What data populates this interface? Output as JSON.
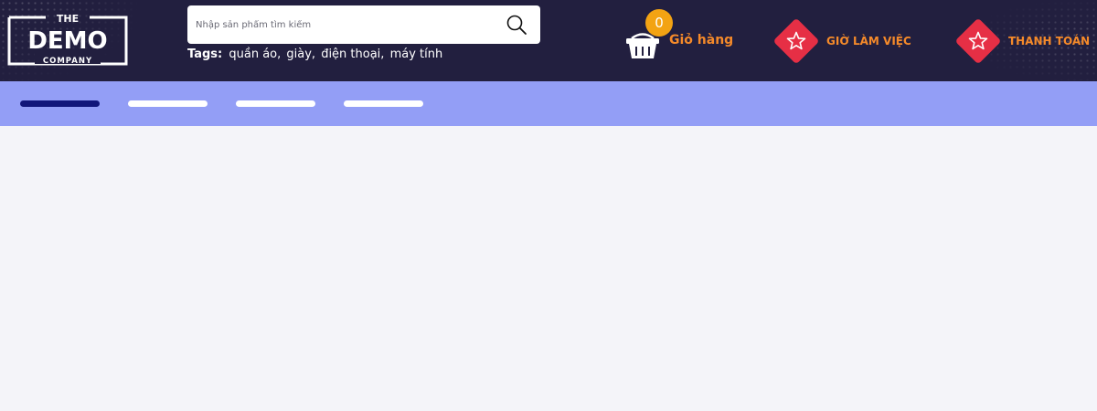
{
  "brand": {
    "logo_top": "THE",
    "logo_main": "DEMO",
    "logo_bottom": "COMPANY"
  },
  "search": {
    "placeholder": "Nhập sản phẩm tìm kiếm",
    "icon": "search-icon"
  },
  "tags": {
    "label": "Tags:",
    "items": [
      "quần áo,",
      "giày,",
      "điện thoại,",
      "máy tính"
    ]
  },
  "cart": {
    "count": "0",
    "label": "Giỏ hàng",
    "icon": "basket-icon"
  },
  "links": [
    {
      "label": "GIỜ LÀM VIỆC",
      "icon": "star-icon"
    },
    {
      "label": "THANH TOÁN",
      "icon": "star-icon"
    }
  ],
  "nav": {
    "tabs": [
      {
        "active": true
      },
      {
        "active": false
      },
      {
        "active": false
      },
      {
        "active": false
      }
    ]
  },
  "colors": {
    "header_bg": "#221f3f",
    "nav_bg": "#939ef6",
    "accent_orange": "#f58a2a",
    "badge": "#f3a313",
    "diamond_red": "#e62f45",
    "active_tab": "#11167a"
  }
}
